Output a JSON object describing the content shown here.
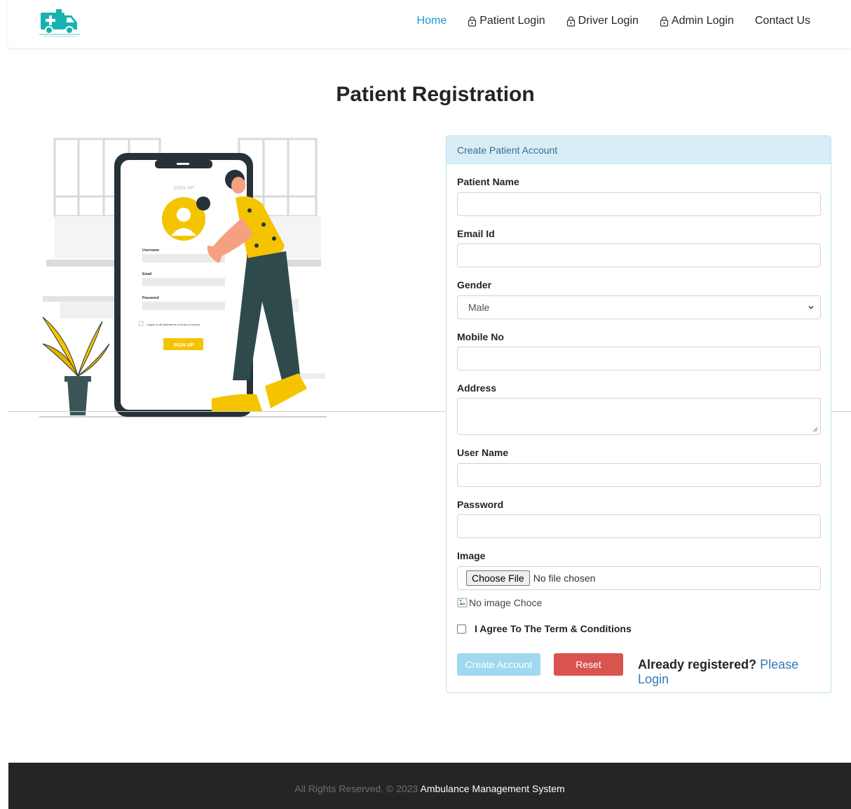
{
  "nav": {
    "links": [
      {
        "label": "Home",
        "icon": "",
        "active": true
      },
      {
        "label": "Patient Login",
        "icon": "lock-icon",
        "active": false
      },
      {
        "label": "Driver Login",
        "icon": "lock-icon",
        "active": false
      },
      {
        "label": "Admin Login",
        "icon": "lock-icon",
        "active": false
      },
      {
        "label": "Contact Us",
        "icon": "",
        "active": false
      }
    ],
    "accent_color": "#1a9ad6",
    "logo_icon": "ambulance-icon"
  },
  "page_title": "Patient Registration",
  "illustration": {
    "icon": "sign-up-illustration",
    "phone_heading": "SIGN UP",
    "username_label": "Username",
    "email_label": "Email",
    "password_label": "Password",
    "agree_text": "I agree to all statements in terms of service",
    "button": "SIGN UP"
  },
  "form": {
    "header": "Create Patient Account",
    "patient_name_label": "Patient Name",
    "patient_name_value": "",
    "email_label": "Email Id",
    "email_value": "",
    "gender_label": "Gender",
    "gender_value": "Male",
    "mobile_label": "Mobile No",
    "mobile_value": "",
    "address_label": "Address",
    "address_value": "",
    "username_label": "User Name",
    "username_value": "",
    "password_label": "Password",
    "password_value": "",
    "image_label": "Image",
    "file_button": "Choose File",
    "file_status": "No file chosen",
    "image_alt": "No image Choce",
    "agree_label": "I Agree To The Term & Conditions",
    "create_button": "Create Account",
    "reset_button": "Reset",
    "already_text": "Already registered?",
    "login_link": "Please Login"
  },
  "footer": {
    "prefix": "All Rights Reserved. © 2023",
    "brand": "Ambulance Management System"
  }
}
